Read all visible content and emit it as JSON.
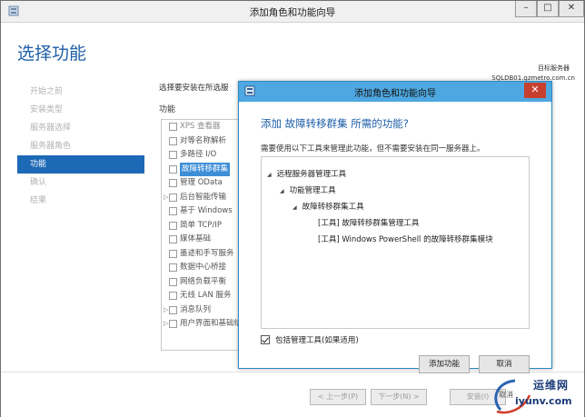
{
  "outer": {
    "title": "添加角色和功能向导",
    "controls": {
      "minimize": "–",
      "maximize": "□",
      "close": "✕"
    },
    "page_title": "选择功能",
    "destination_label": "目标服务器",
    "destination_value": "SQLDB01.gzmetro.com.cn",
    "nav": [
      "开始之前",
      "安装类型",
      "服务器选择",
      "服务器角色",
      "功能",
      "确认",
      "结果"
    ],
    "nav_active_index": 4,
    "content_hint": "选择要安装在所选服",
    "features_label": "功能",
    "features": [
      {
        "label": "XPS 查看器",
        "expander": ""
      },
      {
        "label": "对等名称解析",
        "expander": ""
      },
      {
        "label": "多路径 I/O",
        "expander": ""
      },
      {
        "label": "故障转移群集",
        "expander": "",
        "highlight": true
      },
      {
        "label": "管理 OData",
        "expander": ""
      },
      {
        "label": "后台智能传输",
        "expander": "▷"
      },
      {
        "label": "基于 Windows",
        "expander": ""
      },
      {
        "label": "简单 TCP/IP",
        "expander": ""
      },
      {
        "label": "媒体基础",
        "expander": ""
      },
      {
        "label": "墨迹和手写服务",
        "expander": ""
      },
      {
        "label": "数据中心桥接",
        "expander": ""
      },
      {
        "label": "网络负载平衡",
        "expander": ""
      },
      {
        "label": "无线 LAN 服务",
        "expander": ""
      },
      {
        "label": "消息队列",
        "expander": "▷"
      },
      {
        "label": "用户界面和基础结构",
        "expander": "▷"
      }
    ],
    "footer": {
      "prev": "< 上一步(P)",
      "next": "下一步(N) >",
      "install": "安装(I)",
      "cancel": "取消"
    }
  },
  "dialog": {
    "title": "添加角色和功能向导",
    "close": "✕",
    "heading": "添加 故障转移群集 所需的功能?",
    "description": "需要使用以下工具来管理此功能，但不需要安装在同一服务器上。",
    "tree": [
      "远程服务器管理工具",
      "功能管理工具",
      "故障转移群集工具",
      "[工具] 故障转移群集管理工具",
      "[工具] Windows PowerShell 的故障转移群集模块"
    ],
    "tree_expander": "◢",
    "include_tools_label": "包括管理工具(如果适用)",
    "include_tools_checked": true,
    "add_button": "添加功能",
    "cancel_button": "取消"
  },
  "watermark": {
    "top": "运维网",
    "bottom": "iyunv.com"
  },
  "colors": {
    "accent": "#1c69b6",
    "title_blue": "#1f5fa8",
    "dialog_titlebar": "#4ea7e0",
    "close_red": "#c7402f"
  }
}
